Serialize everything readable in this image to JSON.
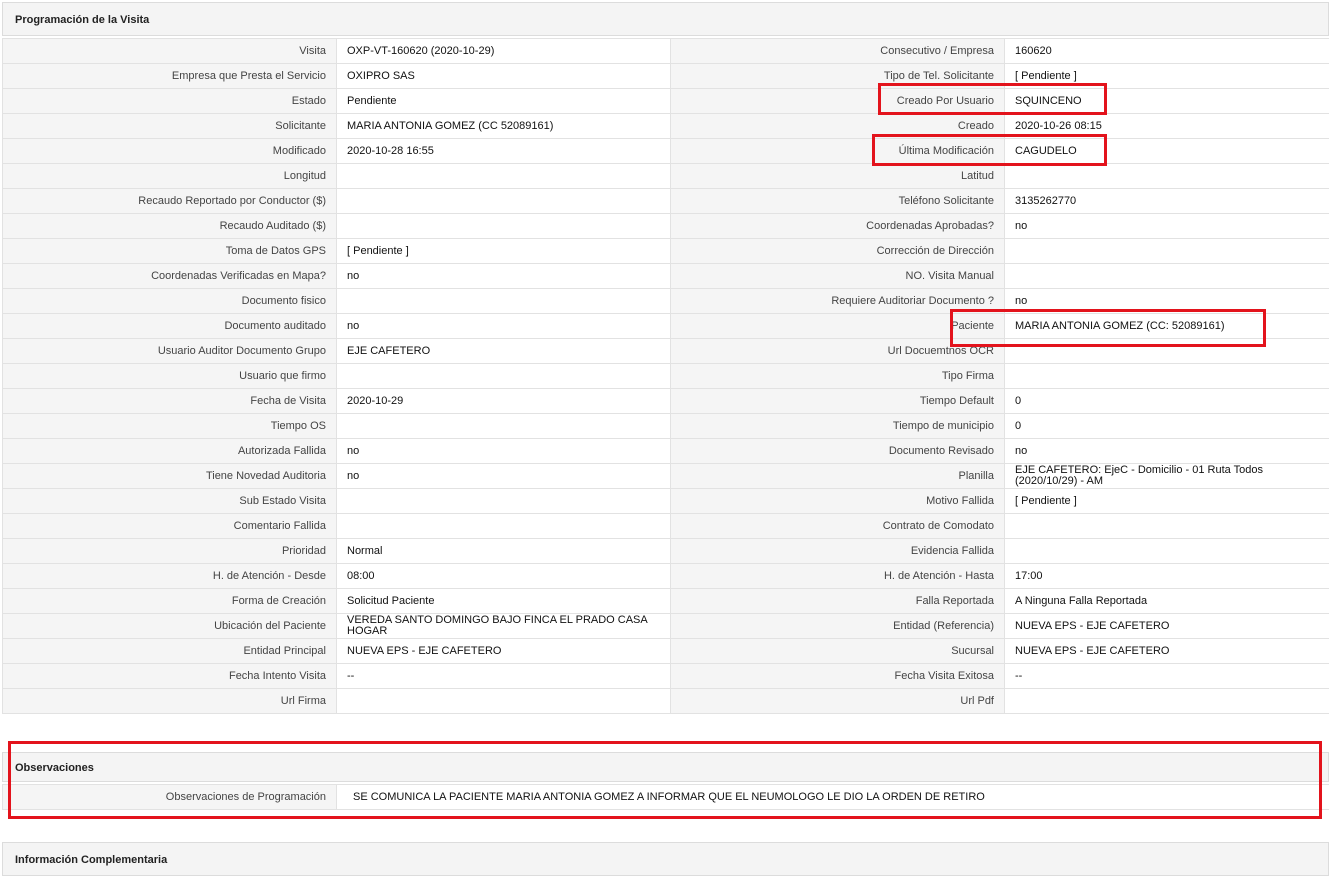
{
  "programacion": {
    "title": "Programación de la Visita",
    "rows": [
      [
        {
          "label": "Visita",
          "value": "OXP-VT-160620 (2020-10-29)"
        },
        {
          "label": "Consecutivo / Empresa",
          "value": "160620"
        }
      ],
      [
        {
          "label": "Empresa que Presta el Servicio",
          "value": "OXIPRO SAS"
        },
        {
          "label": "Tipo de Tel. Solicitante",
          "value": "[ Pendiente ]"
        }
      ],
      [
        {
          "label": "Estado",
          "value": "Pendiente"
        },
        {
          "label": "Creado Por Usuario",
          "value": "SQUINCENO"
        }
      ],
      [
        {
          "label": "Solicitante",
          "value": "MARIA ANTONIA GOMEZ (CC 52089161)"
        },
        {
          "label": "Creado",
          "value": "2020-10-26 08:15"
        }
      ],
      [
        {
          "label": "Modificado",
          "value": "2020-10-28 16:55"
        },
        {
          "label": "Última Modificación",
          "value": "CAGUDELO"
        }
      ],
      [
        {
          "label": "Longitud",
          "value": ""
        },
        {
          "label": "Latitud",
          "value": ""
        }
      ],
      [
        {
          "label": "Recaudo Reportado por Conductor ($)",
          "value": ""
        },
        {
          "label": "Teléfono Solicitante",
          "value": "3135262770"
        }
      ],
      [
        {
          "label": "Recaudo Auditado ($)",
          "value": ""
        },
        {
          "label": "Coordenadas Aprobadas?",
          "value": "no"
        }
      ],
      [
        {
          "label": "Toma de Datos GPS",
          "value": "[ Pendiente ]"
        },
        {
          "label": "Corrección de Dirección",
          "value": ""
        }
      ],
      [
        {
          "label": "Coordenadas Verificadas en Mapa?",
          "value": "no"
        },
        {
          "label": "NO. Visita Manual",
          "value": ""
        }
      ],
      [
        {
          "label": "Documento fisico",
          "value": ""
        },
        {
          "label": "Requiere Auditoriar Documento ?",
          "value": "no"
        }
      ],
      [
        {
          "label": "Documento auditado",
          "value": "no"
        },
        {
          "label": "Paciente",
          "value": "MARIA ANTONIA GOMEZ (CC: 52089161)"
        }
      ],
      [
        {
          "label": "Usuario Auditor Documento Grupo",
          "value": "EJE CAFETERO"
        },
        {
          "label": "Url Docuemtnos OCR",
          "value": ""
        }
      ],
      [
        {
          "label": "Usuario que firmo",
          "value": ""
        },
        {
          "label": "Tipo Firma",
          "value": ""
        }
      ],
      [
        {
          "label": "Fecha de Visita",
          "value": "2020-10-29"
        },
        {
          "label": "Tiempo Default",
          "value": "0"
        }
      ],
      [
        {
          "label": "Tiempo OS",
          "value": ""
        },
        {
          "label": "Tiempo de municipio",
          "value": "0"
        }
      ],
      [
        {
          "label": "Autorizada Fallida",
          "value": "no"
        },
        {
          "label": "Documento Revisado",
          "value": "no"
        }
      ],
      [
        {
          "label": "Tiene Novedad Auditoria",
          "value": "no"
        },
        {
          "label": "Planilla",
          "value": "EJE CAFETERO: EjeC - Domicilio - 01 Ruta Todos (2020/10/29) - AM"
        }
      ],
      [
        {
          "label": "Sub Estado Visita",
          "value": ""
        },
        {
          "label": "Motivo Fallida",
          "value": "[ Pendiente ]"
        }
      ],
      [
        {
          "label": "Comentario Fallida",
          "value": ""
        },
        {
          "label": "Contrato de Comodato",
          "value": ""
        }
      ],
      [
        {
          "label": "Prioridad",
          "value": "Normal"
        },
        {
          "label": "Evidencia Fallida",
          "value": ""
        }
      ],
      [
        {
          "label": "H. de Atención - Desde",
          "value": "08:00"
        },
        {
          "label": "H. de Atención - Hasta",
          "value": "17:00"
        }
      ],
      [
        {
          "label": "Forma de Creación",
          "value": "Solicitud Paciente"
        },
        {
          "label": "Falla Reportada",
          "value": "A Ninguna Falla Reportada"
        }
      ],
      [
        {
          "label": "Ubicación del Paciente",
          "value": "VEREDA SANTO DOMINGO BAJO FINCA EL PRADO CASA HOGAR"
        },
        {
          "label": "Entidad (Referencia)",
          "value": "NUEVA EPS - EJE CAFETERO"
        }
      ],
      [
        {
          "label": "Entidad Principal",
          "value": "NUEVA EPS - EJE CAFETERO"
        },
        {
          "label": "Sucursal",
          "value": "NUEVA EPS - EJE CAFETERO"
        }
      ],
      [
        {
          "label": "Fecha Intento Visita",
          "value": "--"
        },
        {
          "label": "Fecha Visita Exitosa",
          "value": "--"
        }
      ],
      [
        {
          "label": "Url Firma",
          "value": ""
        },
        {
          "label": "Url Pdf",
          "value": ""
        }
      ]
    ]
  },
  "observaciones": {
    "title": "Observaciones",
    "label": "Observaciones de Programación",
    "value": "SE COMUNICA LA PACIENTE MARIA ANTONIA GOMEZ A INFORMAR QUE EL NEUMOLOGO LE DIO LA ORDEN DE RETIRO"
  },
  "complementaria": {
    "title": "Información Complementaria"
  },
  "colors": {
    "highlight": "#e3131c",
    "label_bg": "#f5f5f5",
    "header_bg": "#f4f4f4"
  }
}
